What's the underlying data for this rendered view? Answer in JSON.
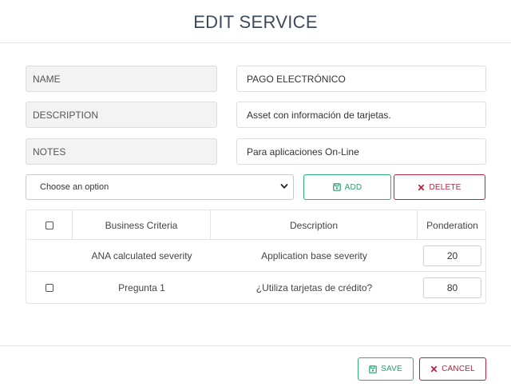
{
  "header": {
    "title": "EDIT SERVICE"
  },
  "fields": [
    {
      "label": "NAME",
      "value": "PAGO ELECTRÓNICO"
    },
    {
      "label": "DESCRIPTION",
      "value": "Asset con información de tarjetas."
    },
    {
      "label": "NOTES",
      "value": "Para aplicaciones On-Line"
    }
  ],
  "select": {
    "value": "Choose an option"
  },
  "actions": {
    "add_label": "ADD",
    "delete_label": "DELETE"
  },
  "table": {
    "headers": [
      "Business Criteria",
      "Description",
      "Ponderation"
    ],
    "rows": [
      {
        "criteria": "ANA calculated severity",
        "description": "Application base severity",
        "ponderation": "20",
        "has_checkbox": false
      },
      {
        "criteria": "Pregunta 1",
        "description": "¿Utiliza tarjetas de crédito?",
        "ponderation": "80",
        "has_checkbox": true
      }
    ]
  },
  "footer": {
    "save_label": "SAVE",
    "cancel_label": "CANCEL"
  },
  "colors": {
    "accent_green": "#2db17a",
    "accent_red": "#b8243f",
    "title": "#3d4a5c"
  }
}
